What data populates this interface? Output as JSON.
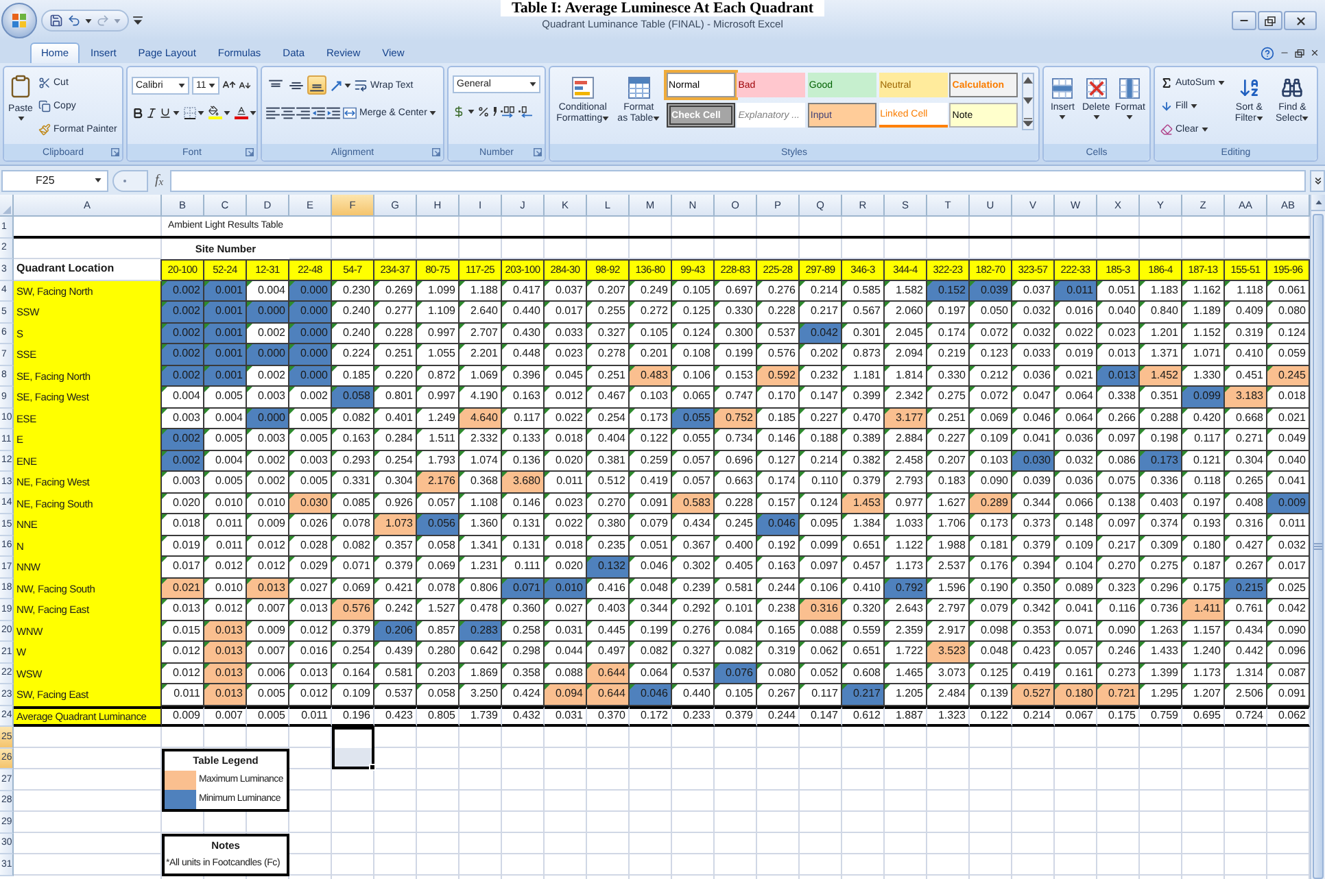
{
  "caption": "Table I: Average Luminesce At Each Quadrant",
  "window": {
    "title": "Quadrant Luminance Table (FINAL) - Microsoft Excel"
  },
  "ribbon_tabs": [
    {
      "label": "Home",
      "selected": true
    },
    {
      "label": "Insert",
      "selected": false
    },
    {
      "label": "Page Layout",
      "selected": false
    },
    {
      "label": "Formulas",
      "selected": false
    },
    {
      "label": "Data",
      "selected": false
    },
    {
      "label": "Review",
      "selected": false
    },
    {
      "label": "View",
      "selected": false
    }
  ],
  "ribbon": {
    "clipboard": {
      "label": "Clipboard",
      "paste": "Paste",
      "cut": "Cut",
      "copy": "Copy",
      "format_painter": "Format Painter"
    },
    "font": {
      "label": "Font",
      "name": "Calibri",
      "size": "11"
    },
    "alignment": {
      "label": "Alignment",
      "vertical": [
        {
          "kind": "top",
          "selected": false
        },
        {
          "kind": "middle",
          "selected": false
        },
        {
          "kind": "bottom",
          "selected": true
        }
      ],
      "wrap_text": "Wrap Text",
      "merge": "Merge & Center"
    },
    "number": {
      "label": "Number",
      "format": "General"
    },
    "styles": {
      "label": "Styles",
      "conditional": "Conditional Formatting",
      "format_table": "Format as Table",
      "gallery": [
        {
          "label": "Normal",
          "kind": "normal",
          "selected": true
        },
        {
          "label": "Bad",
          "kind": "bad",
          "selected": false
        },
        {
          "label": "Good",
          "kind": "good",
          "selected": false
        },
        {
          "label": "Neutral",
          "kind": "neutral",
          "selected": false
        },
        {
          "label": "Calculation",
          "kind": "calculation",
          "selected": false
        },
        {
          "label": "Check Cell",
          "kind": "check",
          "selected": false
        },
        {
          "label": "Explanatory ...",
          "kind": "explanatory",
          "selected": false
        },
        {
          "label": "Input",
          "kind": "input",
          "selected": false
        },
        {
          "label": "Linked Cell",
          "kind": "linked",
          "selected": false
        },
        {
          "label": "Note",
          "kind": "note",
          "selected": false
        }
      ]
    },
    "cells": {
      "label": "Cells",
      "buttons": [
        "Insert",
        "Delete",
        "Format"
      ]
    },
    "editing": {
      "label": "Editing",
      "autosum": "AutoSum",
      "fill": "Fill",
      "clear": "Clear",
      "sort": "Sort & Filter",
      "find": "Find & Select"
    }
  },
  "formula_bar": {
    "name_box": "F25",
    "insert_function": "f$_{x}$"
  },
  "columns": [
    {
      "label": "A",
      "selected": false
    },
    {
      "label": "B",
      "selected": false
    },
    {
      "label": "C",
      "selected": false
    },
    {
      "label": "D",
      "selected": false
    },
    {
      "label": "E",
      "selected": false
    },
    {
      "label": "F",
      "selected": true
    },
    {
      "label": "G",
      "selected": false
    },
    {
      "label": "H",
      "selected": false
    },
    {
      "label": "I",
      "selected": false
    },
    {
      "label": "J",
      "selected": false
    },
    {
      "label": "K",
      "selected": false
    },
    {
      "label": "L",
      "selected": false
    },
    {
      "label": "M",
      "selected": false
    },
    {
      "label": "N",
      "selected": false
    },
    {
      "label": "O",
      "selected": false
    },
    {
      "label": "P",
      "selected": false
    },
    {
      "label": "Q",
      "selected": false
    },
    {
      "label": "R",
      "selected": false
    },
    {
      "label": "S",
      "selected": false
    },
    {
      "label": "T",
      "selected": false
    },
    {
      "label": "U",
      "selected": false
    },
    {
      "label": "V",
      "selected": false
    },
    {
      "label": "W",
      "selected": false
    },
    {
      "label": "X",
      "selected": false
    },
    {
      "label": "Y",
      "selected": false
    },
    {
      "label": "Z",
      "selected": false
    },
    {
      "label": "AA",
      "selected": false
    },
    {
      "label": "AB",
      "selected": false
    }
  ],
  "row_headers": [
    {
      "label": "1",
      "selected": false
    },
    {
      "label": "2",
      "selected": false
    },
    {
      "label": "3",
      "selected": false
    },
    {
      "label": "4",
      "selected": false
    },
    {
      "label": "5",
      "selected": false
    },
    {
      "label": "6",
      "selected": false
    },
    {
      "label": "7",
      "selected": false
    },
    {
      "label": "8",
      "selected": false
    },
    {
      "label": "9",
      "selected": false
    },
    {
      "label": "10",
      "selected": false
    },
    {
      "label": "11",
      "selected": false
    },
    {
      "label": "12",
      "selected": false
    },
    {
      "label": "13",
      "selected": false
    },
    {
      "label": "14",
      "selected": false
    },
    {
      "label": "15",
      "selected": false
    },
    {
      "label": "16",
      "selected": false
    },
    {
      "label": "17",
      "selected": false
    },
    {
      "label": "18",
      "selected": false
    },
    {
      "label": "19",
      "selected": false
    },
    {
      "label": "20",
      "selected": false
    },
    {
      "label": "21",
      "selected": false
    },
    {
      "label": "22",
      "selected": false
    },
    {
      "label": "23",
      "selected": false
    },
    {
      "label": "24",
      "selected": false
    },
    {
      "label": "25",
      "selected": true
    },
    {
      "label": "26",
      "selected": true
    },
    {
      "label": "27",
      "selected": false
    },
    {
      "label": "28",
      "selected": false
    },
    {
      "label": "29",
      "selected": false
    },
    {
      "label": "30",
      "selected": false
    },
    {
      "label": "31",
      "selected": false
    }
  ],
  "sheet": {
    "title": "Ambient Light Results Table",
    "subtitle": "Site Number",
    "location_header": "Quadrant Location",
    "sites": [
      "20-100",
      "52-24",
      "12-31",
      "22-48",
      "54-7",
      "234-37",
      "80-75",
      "117-25",
      "203-100",
      "284-30",
      "98-92",
      "136-80",
      "99-43",
      "228-83",
      "225-28",
      "297-89",
      "346-3",
      "344-4",
      "322-23",
      "182-70",
      "323-57",
      "222-33",
      "185-3",
      "186-4",
      "187-13",
      "155-51",
      "195-96"
    ],
    "rows": [
      {
        "location": "SW, Facing North",
        "error_markers": true,
        "values": [
          "0.002",
          "0.001",
          "0.004",
          "0.000",
          "0.230",
          "0.269",
          "1.099",
          "1.188",
          "0.417",
          "0.037",
          "0.207",
          "0.249",
          "0.105",
          "0.697",
          "0.276",
          "0.214",
          "0.585",
          "1.582",
          "0.152",
          "0.039",
          "0.037",
          "0.011",
          "0.051",
          "1.183",
          "1.162",
          "1.118",
          "0.061"
        ],
        "max": [
          false,
          false,
          false,
          false,
          false,
          false,
          false,
          false,
          false,
          false,
          false,
          false,
          false,
          false,
          false,
          false,
          false,
          false,
          false,
          false,
          false,
          false,
          false,
          false,
          false,
          false,
          false
        ],
        "min": [
          true,
          true,
          false,
          true,
          false,
          false,
          false,
          false,
          false,
          false,
          false,
          false,
          false,
          false,
          false,
          false,
          false,
          false,
          true,
          true,
          false,
          true,
          false,
          false,
          false,
          false,
          false
        ]
      },
      {
        "location": "SSW",
        "error_markers": true,
        "values": [
          "0.002",
          "0.001",
          "0.000",
          "0.000",
          "0.240",
          "0.277",
          "1.109",
          "2.640",
          "0.440",
          "0.017",
          "0.255",
          "0.272",
          "0.125",
          "0.330",
          "0.228",
          "0.217",
          "0.567",
          "2.060",
          "0.197",
          "0.050",
          "0.032",
          "0.016",
          "0.040",
          "0.840",
          "1.189",
          "0.409",
          "0.080"
        ],
        "max": [
          false,
          false,
          false,
          false,
          false,
          false,
          false,
          false,
          false,
          false,
          false,
          false,
          false,
          false,
          false,
          false,
          false,
          false,
          false,
          false,
          false,
          false,
          false,
          false,
          false,
          false,
          false
        ],
        "min": [
          true,
          true,
          true,
          true,
          false,
          false,
          false,
          false,
          false,
          false,
          false,
          false,
          false,
          false,
          false,
          false,
          false,
          false,
          false,
          false,
          false,
          false,
          false,
          false,
          false,
          false,
          false
        ]
      },
      {
        "location": "S",
        "error_markers": true,
        "values": [
          "0.002",
          "0.001",
          "0.002",
          "0.000",
          "0.240",
          "0.228",
          "0.997",
          "2.707",
          "0.430",
          "0.033",
          "0.327",
          "0.105",
          "0.124",
          "0.300",
          "0.537",
          "0.042",
          "0.301",
          "2.045",
          "0.174",
          "0.072",
          "0.032",
          "0.022",
          "0.023",
          "1.201",
          "1.152",
          "0.319",
          "0.124"
        ],
        "max": [
          false,
          false,
          false,
          false,
          false,
          false,
          false,
          false,
          false,
          false,
          false,
          false,
          false,
          false,
          false,
          false,
          false,
          false,
          false,
          false,
          false,
          false,
          false,
          false,
          false,
          false,
          false
        ],
        "min": [
          true,
          true,
          false,
          true,
          false,
          false,
          false,
          false,
          false,
          false,
          false,
          false,
          false,
          false,
          false,
          true,
          false,
          false,
          false,
          false,
          false,
          false,
          false,
          false,
          false,
          false,
          false
        ]
      },
      {
        "location": "SSE",
        "error_markers": true,
        "values": [
          "0.002",
          "0.001",
          "0.000",
          "0.000",
          "0.224",
          "0.251",
          "1.055",
          "2.201",
          "0.448",
          "0.023",
          "0.278",
          "0.201",
          "0.108",
          "0.199",
          "0.576",
          "0.202",
          "0.873",
          "2.094",
          "0.219",
          "0.123",
          "0.033",
          "0.019",
          "0.013",
          "1.371",
          "1.071",
          "0.410",
          "0.059"
        ],
        "max": [
          false,
          false,
          false,
          false,
          false,
          false,
          false,
          false,
          false,
          false,
          false,
          false,
          false,
          false,
          false,
          false,
          false,
          false,
          false,
          false,
          false,
          false,
          false,
          false,
          false,
          false,
          false
        ],
        "min": [
          true,
          true,
          true,
          true,
          false,
          false,
          false,
          false,
          false,
          false,
          false,
          false,
          false,
          false,
          false,
          false,
          false,
          false,
          false,
          false,
          false,
          false,
          false,
          false,
          false,
          false,
          false
        ]
      },
      {
        "location": "SE, Facing North",
        "error_markers": true,
        "values": [
          "0.002",
          "0.001",
          "0.002",
          "0.000",
          "0.185",
          "0.220",
          "0.872",
          "1.069",
          "0.396",
          "0.045",
          "0.251",
          "0.483",
          "0.106",
          "0.153",
          "0.592",
          "0.232",
          "1.181",
          "1.814",
          "0.330",
          "0.212",
          "0.036",
          "0.021",
          "0.013",
          "1.452",
          "1.330",
          "0.451",
          "0.245"
        ],
        "max": [
          false,
          false,
          false,
          false,
          false,
          false,
          false,
          false,
          false,
          false,
          false,
          true,
          false,
          false,
          true,
          false,
          false,
          false,
          false,
          false,
          false,
          false,
          false,
          true,
          false,
          false,
          true
        ],
        "min": [
          true,
          true,
          false,
          true,
          false,
          false,
          false,
          false,
          false,
          false,
          false,
          false,
          false,
          false,
          false,
          false,
          false,
          false,
          false,
          false,
          false,
          false,
          true,
          false,
          false,
          false,
          false
        ]
      },
      {
        "location": "SE, Facing West",
        "error_markers": true,
        "values": [
          "0.004",
          "0.005",
          "0.003",
          "0.002",
          "0.058",
          "0.801",
          "0.997",
          "4.190",
          "0.163",
          "0.012",
          "0.467",
          "0.103",
          "0.065",
          "0.747",
          "0.170",
          "0.147",
          "0.399",
          "2.342",
          "0.275",
          "0.072",
          "0.047",
          "0.064",
          "0.338",
          "0.351",
          "0.099",
          "3.183",
          "0.018"
        ],
        "max": [
          false,
          false,
          false,
          false,
          false,
          false,
          false,
          false,
          false,
          false,
          false,
          false,
          false,
          false,
          false,
          false,
          false,
          false,
          false,
          false,
          false,
          false,
          false,
          false,
          false,
          true,
          false
        ],
        "min": [
          false,
          false,
          false,
          false,
          true,
          false,
          false,
          false,
          false,
          false,
          false,
          false,
          false,
          false,
          false,
          false,
          false,
          false,
          false,
          false,
          false,
          false,
          false,
          false,
          true,
          false,
          false
        ]
      },
      {
        "location": "ESE",
        "error_markers": true,
        "values": [
          "0.003",
          "0.004",
          "0.000",
          "0.005",
          "0.082",
          "0.401",
          "1.249",
          "4.640",
          "0.117",
          "0.022",
          "0.254",
          "0.173",
          "0.055",
          "0.752",
          "0.185",
          "0.227",
          "0.470",
          "3.177",
          "0.251",
          "0.069",
          "0.046",
          "0.064",
          "0.266",
          "0.288",
          "0.420",
          "0.668",
          "0.021"
        ],
        "max": [
          false,
          false,
          false,
          false,
          false,
          false,
          false,
          true,
          false,
          false,
          false,
          false,
          false,
          true,
          false,
          false,
          false,
          true,
          false,
          false,
          false,
          false,
          false,
          false,
          false,
          false,
          false
        ],
        "min": [
          false,
          false,
          true,
          false,
          false,
          false,
          false,
          false,
          false,
          false,
          false,
          false,
          true,
          false,
          false,
          false,
          false,
          false,
          false,
          false,
          false,
          false,
          false,
          false,
          false,
          false,
          false
        ]
      },
      {
        "location": "E",
        "error_markers": true,
        "values": [
          "0.002",
          "0.005",
          "0.003",
          "0.005",
          "0.163",
          "0.284",
          "1.511",
          "2.332",
          "0.133",
          "0.018",
          "0.404",
          "0.122",
          "0.055",
          "0.734",
          "0.146",
          "0.188",
          "0.389",
          "2.884",
          "0.227",
          "0.109",
          "0.041",
          "0.036",
          "0.097",
          "0.198",
          "0.117",
          "0.271",
          "0.049"
        ],
        "max": [
          false,
          false,
          false,
          false,
          false,
          false,
          false,
          false,
          false,
          false,
          false,
          false,
          false,
          false,
          false,
          false,
          false,
          false,
          false,
          false,
          false,
          false,
          false,
          false,
          false,
          false,
          false
        ],
        "min": [
          true,
          false,
          false,
          false,
          false,
          false,
          false,
          false,
          false,
          false,
          false,
          false,
          false,
          false,
          false,
          false,
          false,
          false,
          false,
          false,
          false,
          false,
          false,
          false,
          false,
          false,
          false
        ]
      },
      {
        "location": "ENE",
        "error_markers": true,
        "values": [
          "0.002",
          "0.004",
          "0.002",
          "0.003",
          "0.293",
          "0.254",
          "1.793",
          "1.074",
          "0.136",
          "0.020",
          "0.381",
          "0.259",
          "0.057",
          "0.696",
          "0.127",
          "0.214",
          "0.382",
          "2.458",
          "0.207",
          "0.103",
          "0.030",
          "0.032",
          "0.086",
          "0.173",
          "0.121",
          "0.304",
          "0.040"
        ],
        "max": [
          false,
          false,
          false,
          false,
          false,
          false,
          false,
          false,
          false,
          false,
          false,
          false,
          false,
          false,
          false,
          false,
          false,
          false,
          false,
          false,
          false,
          false,
          false,
          false,
          false,
          false,
          false
        ],
        "min": [
          true,
          false,
          false,
          false,
          false,
          false,
          false,
          false,
          false,
          false,
          false,
          false,
          false,
          false,
          false,
          false,
          false,
          false,
          false,
          false,
          true,
          false,
          false,
          true,
          false,
          false,
          false
        ]
      },
      {
        "location": "NE, Facing West",
        "error_markers": true,
        "values": [
          "0.003",
          "0.005",
          "0.002",
          "0.005",
          "0.331",
          "0.304",
          "2.176",
          "0.368",
          "3.680",
          "0.011",
          "0.512",
          "0.419",
          "0.057",
          "0.663",
          "0.174",
          "0.110",
          "0.379",
          "2.793",
          "0.183",
          "0.090",
          "0.039",
          "0.036",
          "0.075",
          "0.336",
          "0.118",
          "0.265",
          "0.041"
        ],
        "max": [
          false,
          false,
          false,
          false,
          false,
          false,
          true,
          false,
          true,
          false,
          false,
          false,
          false,
          false,
          false,
          false,
          false,
          false,
          false,
          false,
          false,
          false,
          false,
          false,
          false,
          false,
          false
        ],
        "min": [
          false,
          false,
          false,
          false,
          false,
          false,
          false,
          false,
          false,
          false,
          false,
          false,
          false,
          false,
          false,
          false,
          false,
          false,
          false,
          false,
          false,
          false,
          false,
          false,
          false,
          false,
          false
        ]
      },
      {
        "location": "NE, Facing South",
        "error_markers": true,
        "values": [
          "0.020",
          "0.010",
          "0.010",
          "0.030",
          "0.085",
          "0.926",
          "0.057",
          "1.108",
          "0.146",
          "0.023",
          "0.270",
          "0.091",
          "0.583",
          "0.228",
          "0.157",
          "0.124",
          "1.453",
          "0.977",
          "1.627",
          "0.289",
          "0.344",
          "0.066",
          "0.138",
          "0.403",
          "0.197",
          "0.408",
          "0.009"
        ],
        "max": [
          false,
          false,
          false,
          true,
          false,
          false,
          false,
          false,
          false,
          false,
          false,
          false,
          true,
          false,
          false,
          false,
          true,
          false,
          false,
          true,
          false,
          false,
          false,
          false,
          false,
          false,
          false
        ],
        "min": [
          false,
          false,
          false,
          false,
          false,
          false,
          false,
          false,
          false,
          false,
          false,
          false,
          false,
          false,
          false,
          false,
          false,
          false,
          false,
          false,
          false,
          false,
          false,
          false,
          false,
          false,
          true
        ]
      },
      {
        "location": "NNE",
        "error_markers": true,
        "values": [
          "0.018",
          "0.011",
          "0.009",
          "0.026",
          "0.078",
          "1.073",
          "0.056",
          "1.360",
          "0.131",
          "0.022",
          "0.380",
          "0.079",
          "0.434",
          "0.245",
          "0.046",
          "0.095",
          "1.384",
          "1.033",
          "1.706",
          "0.173",
          "0.373",
          "0.148",
          "0.097",
          "0.374",
          "0.193",
          "0.316",
          "0.011"
        ],
        "max": [
          false,
          false,
          false,
          false,
          false,
          true,
          false,
          false,
          false,
          false,
          false,
          false,
          false,
          false,
          false,
          false,
          false,
          false,
          false,
          false,
          false,
          false,
          false,
          false,
          false,
          false,
          false
        ],
        "min": [
          false,
          false,
          false,
          false,
          false,
          false,
          true,
          false,
          false,
          false,
          false,
          false,
          false,
          false,
          true,
          false,
          false,
          false,
          false,
          false,
          false,
          false,
          false,
          false,
          false,
          false,
          false
        ]
      },
      {
        "location": "N",
        "error_markers": true,
        "values": [
          "0.019",
          "0.011",
          "0.012",
          "0.028",
          "0.082",
          "0.357",
          "0.058",
          "1.341",
          "0.131",
          "0.018",
          "0.235",
          "0.051",
          "0.367",
          "0.400",
          "0.192",
          "0.099",
          "0.651",
          "1.122",
          "1.988",
          "0.181",
          "0.379",
          "0.109",
          "0.217",
          "0.309",
          "0.180",
          "0.427",
          "0.032"
        ],
        "max": [
          false,
          false,
          false,
          false,
          false,
          false,
          false,
          false,
          false,
          false,
          false,
          false,
          false,
          false,
          false,
          false,
          false,
          false,
          false,
          false,
          false,
          false,
          false,
          false,
          false,
          false,
          false
        ],
        "min": [
          false,
          false,
          false,
          false,
          false,
          false,
          false,
          false,
          false,
          false,
          false,
          false,
          false,
          false,
          false,
          false,
          false,
          false,
          false,
          false,
          false,
          false,
          false,
          false,
          false,
          false,
          false
        ]
      },
      {
        "location": "NNW",
        "error_markers": true,
        "values": [
          "0.017",
          "0.012",
          "0.012",
          "0.029",
          "0.071",
          "0.379",
          "0.069",
          "1.231",
          "0.111",
          "0.020",
          "0.132",
          "0.046",
          "0.302",
          "0.405",
          "0.163",
          "0.097",
          "0.457",
          "1.173",
          "2.537",
          "0.176",
          "0.394",
          "0.104",
          "0.270",
          "0.275",
          "0.187",
          "0.267",
          "0.017"
        ],
        "max": [
          false,
          false,
          false,
          false,
          false,
          false,
          false,
          false,
          false,
          false,
          false,
          false,
          false,
          false,
          false,
          false,
          false,
          false,
          false,
          false,
          false,
          false,
          false,
          false,
          false,
          false,
          false
        ],
        "min": [
          false,
          false,
          false,
          false,
          false,
          false,
          false,
          false,
          false,
          false,
          true,
          false,
          false,
          false,
          false,
          false,
          false,
          false,
          false,
          false,
          false,
          false,
          false,
          false,
          false,
          false,
          false
        ]
      },
      {
        "location": "NW, Facing South",
        "error_markers": true,
        "values": [
          "0.021",
          "0.010",
          "0.013",
          "0.027",
          "0.069",
          "0.421",
          "0.078",
          "0.806",
          "0.071",
          "0.010",
          "0.416",
          "0.048",
          "0.239",
          "0.581",
          "0.244",
          "0.106",
          "0.410",
          "0.792",
          "1.596",
          "0.190",
          "0.350",
          "0.089",
          "0.323",
          "0.296",
          "0.175",
          "0.215",
          "0.025"
        ],
        "max": [
          true,
          false,
          true,
          false,
          false,
          false,
          false,
          false,
          false,
          false,
          false,
          false,
          false,
          false,
          false,
          false,
          false,
          false,
          false,
          false,
          false,
          false,
          false,
          false,
          false,
          false,
          false
        ],
        "min": [
          false,
          false,
          false,
          false,
          false,
          false,
          false,
          false,
          true,
          true,
          false,
          false,
          false,
          false,
          false,
          false,
          false,
          true,
          false,
          false,
          false,
          false,
          false,
          false,
          false,
          true,
          false
        ]
      },
      {
        "location": "NW, Facing East",
        "error_markers": true,
        "values": [
          "0.013",
          "0.012",
          "0.007",
          "0.013",
          "0.576",
          "0.242",
          "1.527",
          "0.478",
          "0.360",
          "0.027",
          "0.403",
          "0.344",
          "0.292",
          "0.101",
          "0.238",
          "0.316",
          "0.320",
          "2.643",
          "2.797",
          "0.079",
          "0.342",
          "0.041",
          "0.116",
          "0.736",
          "1.411",
          "0.761",
          "0.042"
        ],
        "max": [
          false,
          false,
          false,
          false,
          true,
          false,
          false,
          false,
          false,
          false,
          false,
          false,
          false,
          false,
          false,
          true,
          false,
          false,
          false,
          false,
          false,
          false,
          false,
          false,
          true,
          false,
          false
        ],
        "min": [
          false,
          false,
          false,
          false,
          false,
          false,
          false,
          false,
          false,
          false,
          false,
          false,
          false,
          false,
          false,
          false,
          false,
          false,
          false,
          false,
          false,
          false,
          false,
          false,
          false,
          false,
          false
        ]
      },
      {
        "location": "WNW",
        "error_markers": true,
        "values": [
          "0.015",
          "0.013",
          "0.009",
          "0.012",
          "0.379",
          "0.206",
          "0.857",
          "0.283",
          "0.258",
          "0.031",
          "0.445",
          "0.199",
          "0.276",
          "0.084",
          "0.165",
          "0.088",
          "0.559",
          "2.359",
          "2.917",
          "0.098",
          "0.353",
          "0.071",
          "0.090",
          "1.263",
          "1.157",
          "0.434",
          "0.090"
        ],
        "max": [
          false,
          true,
          false,
          false,
          false,
          false,
          false,
          false,
          false,
          false,
          false,
          false,
          false,
          false,
          false,
          false,
          false,
          false,
          false,
          false,
          false,
          false,
          false,
          false,
          false,
          false,
          false
        ],
        "min": [
          false,
          false,
          false,
          false,
          false,
          true,
          false,
          true,
          false,
          false,
          false,
          false,
          false,
          false,
          false,
          false,
          false,
          false,
          false,
          false,
          false,
          false,
          false,
          false,
          false,
          false,
          false
        ]
      },
      {
        "location": "W",
        "error_markers": true,
        "values": [
          "0.012",
          "0.013",
          "0.007",
          "0.016",
          "0.254",
          "0.439",
          "0.280",
          "0.642",
          "0.298",
          "0.044",
          "0.497",
          "0.082",
          "0.327",
          "0.082",
          "0.319",
          "0.062",
          "0.651",
          "1.722",
          "3.523",
          "0.048",
          "0.423",
          "0.057",
          "0.246",
          "1.433",
          "1.240",
          "0.442",
          "0.096"
        ],
        "max": [
          false,
          true,
          false,
          false,
          false,
          false,
          false,
          false,
          false,
          false,
          false,
          false,
          false,
          false,
          false,
          false,
          false,
          false,
          true,
          false,
          false,
          false,
          false,
          false,
          false,
          false,
          false
        ],
        "min": [
          false,
          false,
          false,
          false,
          false,
          false,
          false,
          false,
          false,
          false,
          false,
          false,
          false,
          false,
          false,
          false,
          false,
          false,
          false,
          false,
          false,
          false,
          false,
          false,
          false,
          false,
          false
        ]
      },
      {
        "location": "WSW",
        "error_markers": true,
        "values": [
          "0.012",
          "0.013",
          "0.006",
          "0.013",
          "0.164",
          "0.581",
          "0.203",
          "1.869",
          "0.358",
          "0.088",
          "0.644",
          "0.064",
          "0.537",
          "0.076",
          "0.080",
          "0.052",
          "0.608",
          "1.465",
          "3.073",
          "0.125",
          "0.419",
          "0.161",
          "0.273",
          "1.399",
          "1.173",
          "1.314",
          "0.087"
        ],
        "max": [
          false,
          true,
          false,
          false,
          false,
          false,
          false,
          false,
          false,
          false,
          true,
          false,
          false,
          false,
          false,
          false,
          false,
          false,
          false,
          false,
          false,
          false,
          false,
          false,
          false,
          false,
          false
        ],
        "min": [
          false,
          false,
          false,
          false,
          false,
          false,
          false,
          false,
          false,
          false,
          false,
          false,
          false,
          true,
          false,
          false,
          false,
          false,
          false,
          false,
          false,
          false,
          false,
          false,
          false,
          false,
          false
        ]
      },
      {
        "location": "SW, Facing East",
        "error_markers": true,
        "values": [
          "0.011",
          "0.013",
          "0.005",
          "0.012",
          "0.109",
          "0.537",
          "0.058",
          "3.250",
          "0.424",
          "0.094",
          "0.644",
          "0.046",
          "0.440",
          "0.105",
          "0.267",
          "0.117",
          "0.217",
          "1.205",
          "2.484",
          "0.139",
          "0.527",
          "0.180",
          "0.721",
          "1.295",
          "1.207",
          "2.506",
          "0.091"
        ],
        "max": [
          false,
          true,
          false,
          false,
          false,
          false,
          false,
          false,
          false,
          true,
          true,
          false,
          false,
          false,
          false,
          false,
          false,
          false,
          false,
          false,
          true,
          true,
          true,
          false,
          false,
          false,
          false
        ],
        "min": [
          false,
          false,
          false,
          false,
          false,
          false,
          false,
          false,
          false,
          false,
          false,
          true,
          false,
          false,
          false,
          false,
          true,
          false,
          false,
          false,
          false,
          false,
          false,
          false,
          false,
          false,
          false
        ]
      }
    ],
    "average": {
      "label": "Average Quadrant Luminance",
      "values": [
        "0.009",
        "0.007",
        "0.005",
        "0.011",
        "0.196",
        "0.423",
        "0.805",
        "1.739",
        "0.432",
        "0.031",
        "0.370",
        "0.172",
        "0.233",
        "0.379",
        "0.244",
        "0.147",
        "0.612",
        "1.887",
        "1.323",
        "0.122",
        "0.214",
        "0.067",
        "0.175",
        "0.759",
        "0.695",
        "0.724",
        "0.062"
      ]
    },
    "legend": {
      "title": "Table Legend",
      "items": [
        {
          "kind": "max",
          "label": "Maximum Luminance",
          "color": "#fabf8f"
        },
        {
          "kind": "min",
          "label": "Minimum Luminance",
          "color": "#4f81bd"
        }
      ]
    },
    "notes": {
      "title": "Notes",
      "text": "*All units in Footcandles (Fc)"
    }
  }
}
